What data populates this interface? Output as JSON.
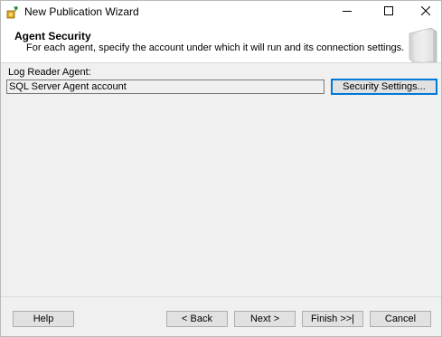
{
  "window": {
    "title": "New Publication Wizard",
    "app_icon": "wizard-app-icon",
    "controls": [
      "minimize-icon",
      "maximize-icon",
      "close-icon"
    ]
  },
  "header": {
    "title": "Agent Security",
    "subtitle": "For each agent, specify the account under which it will run and its connection settings.",
    "graphic_icon": "wizard-page-graphic"
  },
  "agent": {
    "label": "Log Reader Agent:",
    "account_value": "SQL Server Agent account",
    "security_button": "Security Settings..."
  },
  "footer": {
    "help": "Help",
    "back": "< Back",
    "next": "Next >",
    "finish": "Finish >>|",
    "cancel": "Cancel"
  },
  "colors": {
    "accent_focus": "#0078d7",
    "background": "#f0f0f0",
    "header_bg": "#ffffff"
  }
}
